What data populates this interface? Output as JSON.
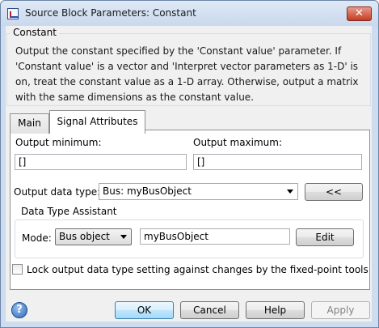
{
  "window": {
    "title": "Source Block Parameters: Constant",
    "close_label": "✕"
  },
  "block": {
    "name": "Constant",
    "description": "Output the constant specified by the 'Constant value' parameter. If 'Constant value' is a vector and 'Interpret vector parameters as 1-D' is on, treat the constant value as a 1-D array. Otherwise, output a matrix with the same dimensions as the constant value."
  },
  "tabs": [
    {
      "label": "Main",
      "active": false
    },
    {
      "label": "Signal Attributes",
      "active": true
    }
  ],
  "signal_attributes": {
    "output_minimum_label": "Output minimum:",
    "output_minimum_value": "[]",
    "output_maximum_label": "Output maximum:",
    "output_maximum_value": "[]",
    "output_data_type_label": "Output data type:",
    "output_data_type_value": "Bus: myBusObject",
    "assistant_toggle_label": "<<",
    "data_type_assistant": {
      "label": "Data Type Assistant",
      "mode_label": "Mode:",
      "mode_value": "Bus object",
      "bus_object_value": "myBusObject",
      "edit_label": "Edit"
    },
    "lock_checkbox_label": "Lock output data type setting against changes by the fixed-point tools",
    "lock_checked": false
  },
  "footer": {
    "help_icon": "question-icon",
    "help_glyph": "?",
    "ok_label": "OK",
    "cancel_label": "Cancel",
    "help_label": "Help",
    "apply_label": "Apply"
  },
  "colors": {
    "accent": "#3c7fb1",
    "close": "#c43b22",
    "frame": "#cddcef"
  }
}
